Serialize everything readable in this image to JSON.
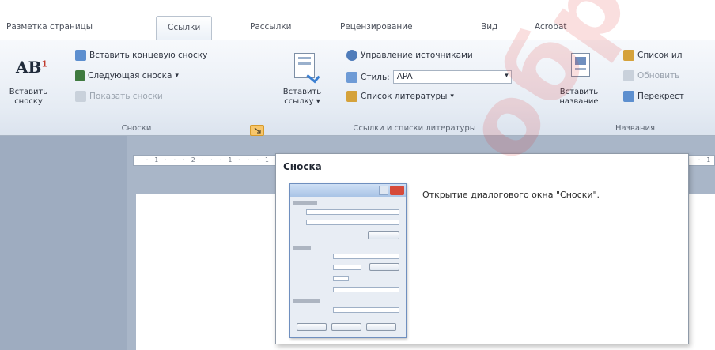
{
  "tabs": [
    {
      "label": "Разметка страницы",
      "active": false
    },
    {
      "label": "Ссылки",
      "active": true
    },
    {
      "label": "Рассылки",
      "active": false
    },
    {
      "label": "Рецензирование",
      "active": false
    },
    {
      "label": "Вид",
      "active": false
    },
    {
      "label": "Acrobat",
      "active": false
    }
  ],
  "ribbon": {
    "footnotes_group": {
      "label": "Сноски",
      "insert_footnote_big": "AB",
      "insert_footnote_sup": "1",
      "insert_footnote_line1": "Вставить",
      "insert_footnote_line2": "сноску",
      "insert_endnote": "Вставить концевую сноску",
      "next_footnote": "Следующая сноска",
      "next_footnote_arrow": "▾",
      "show_notes": "Показать сноски",
      "launcher_icon": "dialog-launcher-icon"
    },
    "citations_group": {
      "label": "Ссылки и списки литературы",
      "insert_citation_line1": "Вставить",
      "insert_citation_line2": "ссылку",
      "insert_citation_arrow": "▾",
      "manage_sources": "Управление источниками",
      "style_label": "Стиль:",
      "style_value": "APA",
      "bibliography": "Список литературы",
      "bibliography_arrow": "▾"
    },
    "captions_group": {
      "label": "Названия",
      "insert_caption_line1": "Вставить",
      "insert_caption_line2": "название",
      "table_of_figures": "Список ил",
      "update_table": "Обновить",
      "cross_reference": "Перекрест"
    }
  },
  "ruler": {
    "text": "· · 1 · · · 2 · · · 1 · · · 1 · · · · · · · · · · · · · · · · · · · · · · · · · · · · · · · · · · · · · · · · · · · · · · · 1 · · ·"
  },
  "tooltip": {
    "title": "Сноска",
    "description": "Открытие диалогового окна \"Сноски\".",
    "preview_icon": "footnote-dialog-preview"
  },
  "watermark": {
    "text": "обрасла"
  },
  "colors": {
    "ribbon_bg": "#e6ecf4",
    "doc_bg": "#a9b6c8",
    "launcher_highlight": "#f7c66b",
    "watermark": "#e23a3a"
  }
}
